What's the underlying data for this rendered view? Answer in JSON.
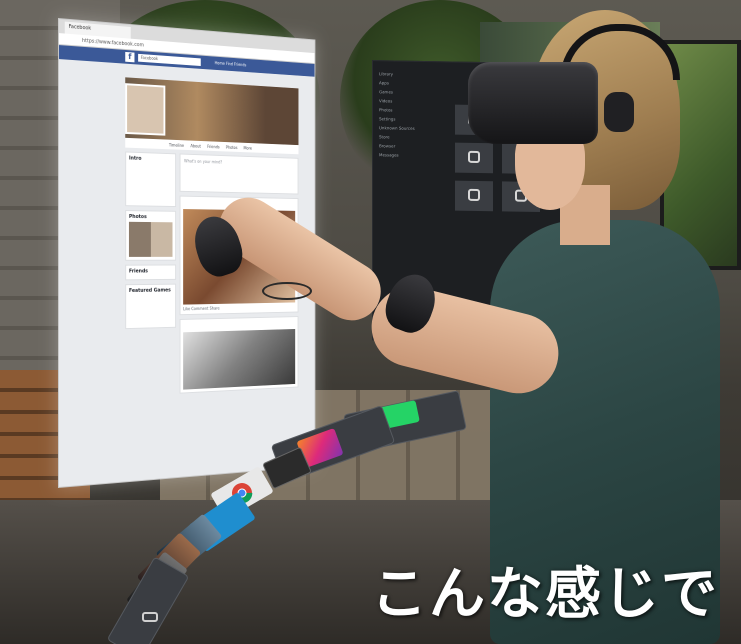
{
  "caption": {
    "text": "こんな感じで"
  },
  "browser": {
    "tab_title": "Facebook",
    "address": "https://www.facebook.com",
    "search_placeholder": "Facebook",
    "nav": "Home  Find Friends",
    "profile_name": "",
    "profile_tabs": "Timeline  About  Friends  Photos  More",
    "left_cards": [
      {
        "title": "Intro",
        "text": ""
      },
      {
        "title": "Photos",
        "text": ""
      },
      {
        "title": "Friends",
        "text": ""
      },
      {
        "title": "Featured Games",
        "text": ""
      }
    ],
    "post_box_placeholder": "What's on your mind?",
    "post_actions": "Like   Comment   Share"
  },
  "library": {
    "menu_items": [
      "Library",
      "Apps",
      "Games",
      "Videos",
      "Photos",
      "Settings",
      "Unknown Sources",
      "Store",
      "Browser",
      "Messages"
    ],
    "tiles": [
      "app",
      "app",
      "app",
      "app",
      "app",
      "app"
    ]
  },
  "dock": {
    "apps": [
      {
        "name": "whatsapp-icon",
        "color": "#25d366"
      },
      {
        "name": "facebook-icon",
        "color": "#3b5998",
        "glyph": "f"
      },
      {
        "name": "instagram-icon",
        "color": "#c13584"
      },
      {
        "name": "oculus-icon",
        "color": "#2b2b2b"
      },
      {
        "name": "chrome-icon",
        "color": "#e8e8e8"
      },
      {
        "name": "store-icon",
        "color": "#1f8ecf"
      }
    ]
  },
  "colors": {
    "facebook_blue": "#3b5998",
    "shirt": "#2c4644",
    "headset": "#151517"
  }
}
